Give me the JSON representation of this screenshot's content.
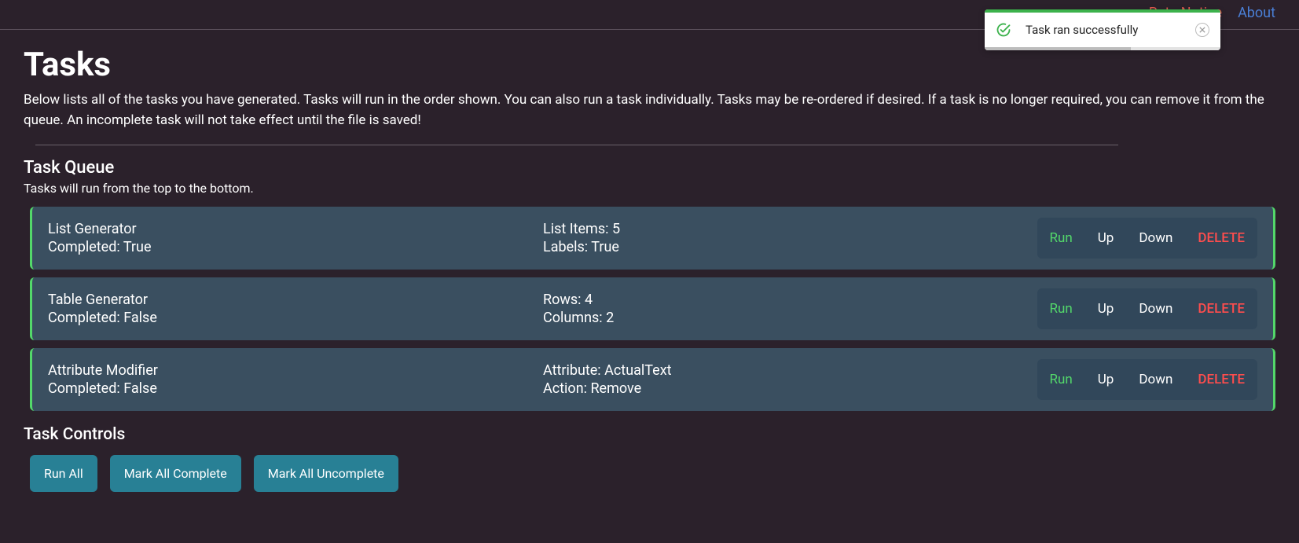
{
  "nav": {
    "beta_notice": "Beta Notice",
    "about": "About"
  },
  "toast": {
    "message": "Task ran successfully"
  },
  "page": {
    "title": "Tasks",
    "subtitle": "Below lists all of the tasks you have generated. Tasks will run in the order shown. You can also run a task individually. Tasks may be re-ordered if desired. If a task is no longer required, you can remove it from the queue. An incomplete task will not take effect until the file is saved!",
    "queue_heading": "Task Queue",
    "queue_desc": "Tasks will run from the top to the bottom.",
    "controls_heading": "Task Controls"
  },
  "actions": {
    "run": "Run",
    "up": "Up",
    "down": "Down",
    "delete": "DELETE"
  },
  "controls": {
    "run_all": "Run All",
    "mark_all_complete": "Mark All Complete",
    "mark_all_uncomplete": "Mark All Uncomplete"
  },
  "tasks": [
    {
      "name": "List Generator",
      "completed_line": "Completed: True",
      "detail1": "List Items: 5",
      "detail2": "Labels: True"
    },
    {
      "name": "Table Generator",
      "completed_line": "Completed: False",
      "detail1": "Rows: 4",
      "detail2": "Columns: 2"
    },
    {
      "name": "Attribute Modifier",
      "completed_line": "Completed: False",
      "detail1": "Attribute: ActualText",
      "detail2": "Action: Remove"
    }
  ]
}
